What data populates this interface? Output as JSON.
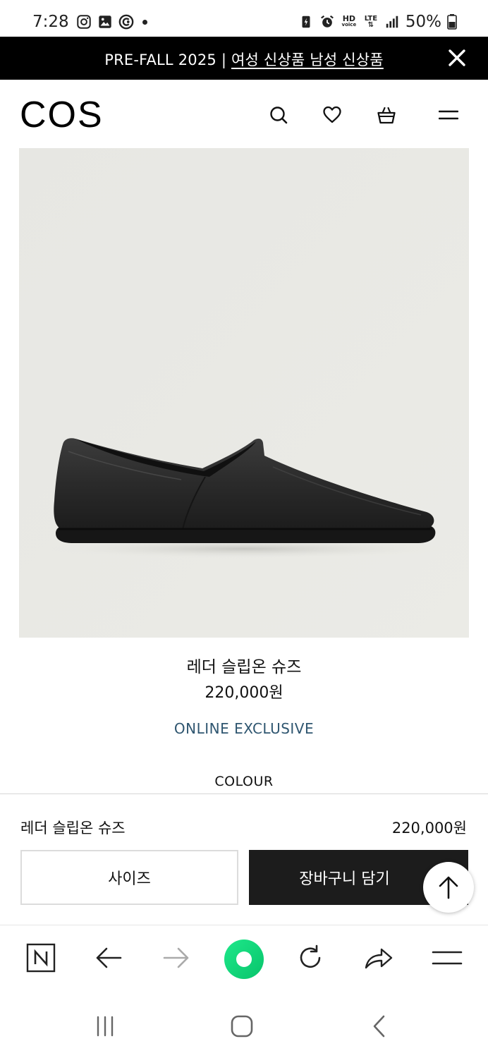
{
  "status_bar": {
    "time": "7:28",
    "battery": "50%",
    "icons_left": [
      "instagram-icon",
      "gallery-icon",
      "cast-icon",
      "dot"
    ],
    "icons_right": [
      "battery-saver-icon",
      "alarm-icon",
      "hd-voice-icon",
      "lte-icon",
      "signal-icon",
      "battery-icon"
    ],
    "hd_label": "HD",
    "voice_label": "voice",
    "lte_label": "LTE"
  },
  "promo": {
    "prefix": "PRE-FALL 2025 | ",
    "links": "여성 신상품 남성 신상품",
    "background": "#000000"
  },
  "header": {
    "logo": "COS",
    "icons": [
      "search-icon",
      "heart-icon",
      "basket-icon",
      "menu-icon"
    ]
  },
  "product": {
    "name": "레더 슬립온 슈즈",
    "price": "220,000원",
    "badge": "ONLINE EXCLUSIVE",
    "badge_color": "#2f5670",
    "colour_label": "COLOUR"
  },
  "purchase_bar": {
    "name": "레더 슬립온 슈즈",
    "price": "220,000원",
    "size_label": "사이즈",
    "cart_label": "장바구니 담기"
  },
  "browser_toolbar": {
    "icons": [
      "naver-n-icon",
      "back-arrow-icon",
      "forward-arrow-icon",
      "home-green-icon",
      "refresh-icon",
      "share-icon",
      "menu-icon"
    ],
    "accent": "#1ee88a"
  },
  "system_nav": {
    "icons": [
      "recent-apps-icon",
      "home-icon",
      "back-icon"
    ]
  }
}
